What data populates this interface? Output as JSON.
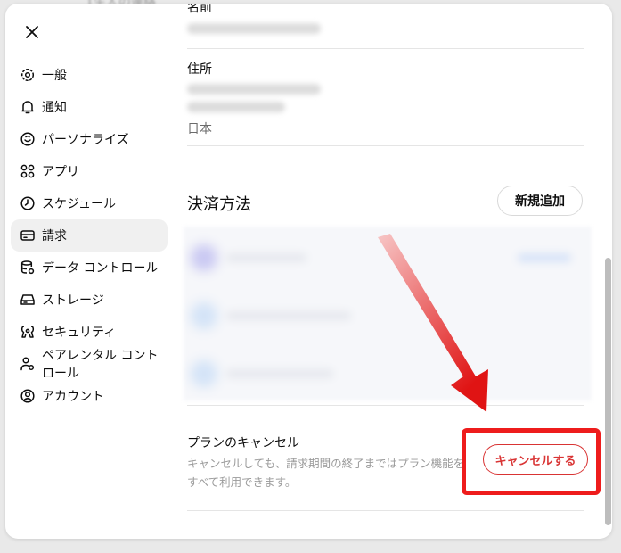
{
  "background": {
    "text": "1生人の連絡"
  },
  "sidebar": {
    "close_icon": "close-icon",
    "items": [
      {
        "label": "一般",
        "icon": "gear-icon",
        "active": false
      },
      {
        "label": "通知",
        "icon": "bell-icon",
        "active": false
      },
      {
        "label": "パーソナライズ",
        "icon": "personalize-icon",
        "active": false
      },
      {
        "label": "アプリ",
        "icon": "apps-icon",
        "active": false
      },
      {
        "label": "スケジュール",
        "icon": "clock-icon",
        "active": false
      },
      {
        "label": "請求",
        "icon": "card-icon",
        "active": true
      },
      {
        "label": "データ コントロール",
        "icon": "database-gear-icon",
        "active": false
      },
      {
        "label": "ストレージ",
        "icon": "storage-icon",
        "active": false
      },
      {
        "label": "セキュリティ",
        "icon": "shield-icon",
        "active": false
      },
      {
        "label": "ペアレンタル コントロール",
        "icon": "parental-icon",
        "active": false
      },
      {
        "label": "アカウント",
        "icon": "account-icon",
        "active": false
      }
    ]
  },
  "billing": {
    "name_label": "名前",
    "address_label": "住所",
    "country": "日本",
    "payment_method_title": "決済方法",
    "add_new_button": "新規追加",
    "cancel_plan_title": "プランのキャンセル",
    "cancel_plan_description": "キャンセルしても、請求期間の終了まではプラン機能をすべて利用できます。",
    "cancel_button": "キャンセルする"
  },
  "colors": {
    "danger": "#d93434",
    "highlight": "#ee1c1c",
    "active_bg": "#f0f0f0"
  }
}
